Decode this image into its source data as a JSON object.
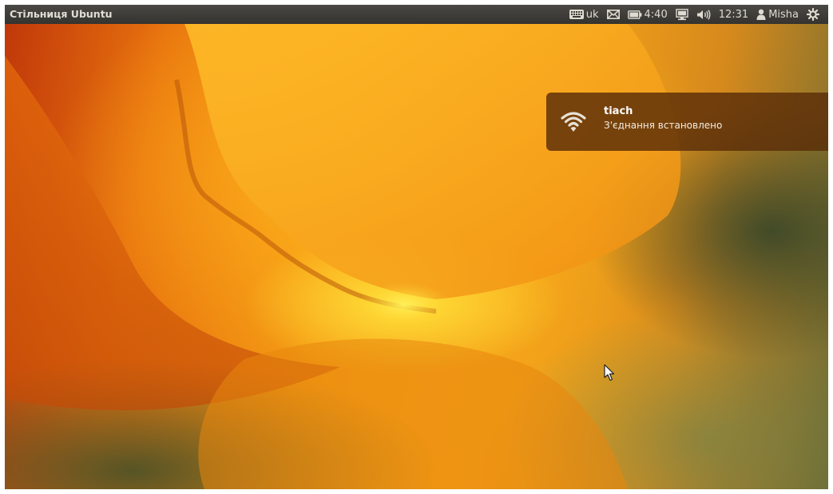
{
  "panel": {
    "title": "Стільниця Ubuntu",
    "keyboard_layout": "uk",
    "battery_time": "4:40",
    "clock": "12:31",
    "user": "Misha",
    "icons": {
      "keyboard": "keyboard-icon",
      "mail": "mail-icon",
      "battery": "battery-icon",
      "network": "network-icon",
      "volume": "volume-icon",
      "user": "user-icon",
      "session": "gear-icon"
    }
  },
  "notification": {
    "title": "tiach",
    "body": "З'єднання встановлено",
    "icon": "wifi-icon"
  },
  "colors": {
    "panel_bg": "#3c3b37",
    "panel_text": "#dfdbd2",
    "notification_bg": "#5a2d08"
  }
}
